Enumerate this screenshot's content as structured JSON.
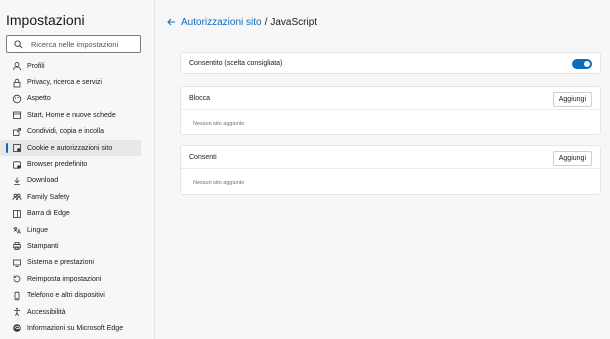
{
  "sidebar": {
    "title": "Impostazioni",
    "search_placeholder": "Ricerca nelle impostazioni",
    "items": [
      {
        "label": "Profili",
        "icon": "profile-icon"
      },
      {
        "label": "Privacy, ricerca e servizi",
        "icon": "lock-icon"
      },
      {
        "label": "Aspetto",
        "icon": "appearance-icon"
      },
      {
        "label": "Start, Home e nuove schede",
        "icon": "home-icon"
      },
      {
        "label": "Condividi, copia e incolla",
        "icon": "share-icon"
      },
      {
        "label": "Cookie e autorizzazioni sito",
        "icon": "cookie-icon",
        "active": true
      },
      {
        "label": "Browser predefinito",
        "icon": "browser-icon"
      },
      {
        "label": "Download",
        "icon": "download-icon"
      },
      {
        "label": "Family Safety",
        "icon": "family-icon"
      },
      {
        "label": "Barra di Edge",
        "icon": "edge-bar-icon"
      },
      {
        "label": "Lingue",
        "icon": "language-icon"
      },
      {
        "label": "Stampanti",
        "icon": "printer-icon"
      },
      {
        "label": "Sistema e prestazioni",
        "icon": "system-icon"
      },
      {
        "label": "Reimposta impostazioni",
        "icon": "reset-icon"
      },
      {
        "label": "Telefono e altri dispositivi",
        "icon": "phone-icon"
      },
      {
        "label": "Accessibilità",
        "icon": "accessibility-icon"
      },
      {
        "label": "Informazioni su Microsoft Edge",
        "icon": "edge-icon"
      }
    ]
  },
  "header": {
    "breadcrumb_link": "Autorizzazioni sito",
    "separator": "/",
    "current": "JavaScript"
  },
  "allowed_card": {
    "label": "Consentito (scelta consigliata)",
    "toggle_on": true
  },
  "block_card": {
    "title": "Blocca",
    "add_label": "Aggiungi",
    "empty_text": "Nessun sito aggiunto"
  },
  "allow_card": {
    "title": "Consenti",
    "add_label": "Aggiungi",
    "empty_text": "Nessun sito aggiunto"
  },
  "colors": {
    "accent": "#0f6cbd",
    "background": "#f7f7f7",
    "card": "#ffffff"
  }
}
